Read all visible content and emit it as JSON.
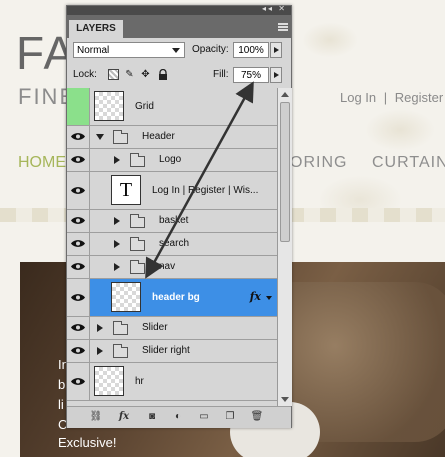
{
  "website": {
    "logo_partial": "FA",
    "tagline_partial": "FINE",
    "top_links": [
      "Log In",
      "|",
      "Register",
      "|"
    ],
    "nav": {
      "home": "HOME",
      "item_partial": "ORING",
      "curtains": "CURTAINS"
    },
    "hero_text": [
      "In",
      "b",
      "li",
      "C",
      "Exclusive!"
    ]
  },
  "panel": {
    "tab_label": "LAYERS",
    "blend_mode": "Normal",
    "opacity_label": "Opacity:",
    "opacity_value": "100%",
    "lock_label": "Lock:",
    "fill_label": "Fill:",
    "fill_value": "75%",
    "layers": [
      {
        "name": "Grid",
        "type": "pixel",
        "eye_color": "#8be08b"
      },
      {
        "name": "Header",
        "type": "group",
        "expanded": true
      },
      {
        "name": "Logo",
        "type": "group"
      },
      {
        "name": "Log In | Register | Wis...",
        "type": "text"
      },
      {
        "name": "basket",
        "type": "group"
      },
      {
        "name": "search",
        "type": "group"
      },
      {
        "name": "nav",
        "type": "group"
      },
      {
        "name": "header bg",
        "type": "pixel",
        "selected": true,
        "fx": "fx"
      },
      {
        "name": "Slider",
        "type": "group"
      },
      {
        "name": "Slider right",
        "type": "group"
      },
      {
        "name": "hr",
        "type": "pixel"
      }
    ],
    "bottom_icons": [
      "link-icon",
      "fx-icon",
      "mask-icon",
      "adjustment-icon",
      "new-group-icon",
      "new-layer-icon",
      "trash-icon"
    ],
    "selected_color": "#3d8fe6"
  }
}
